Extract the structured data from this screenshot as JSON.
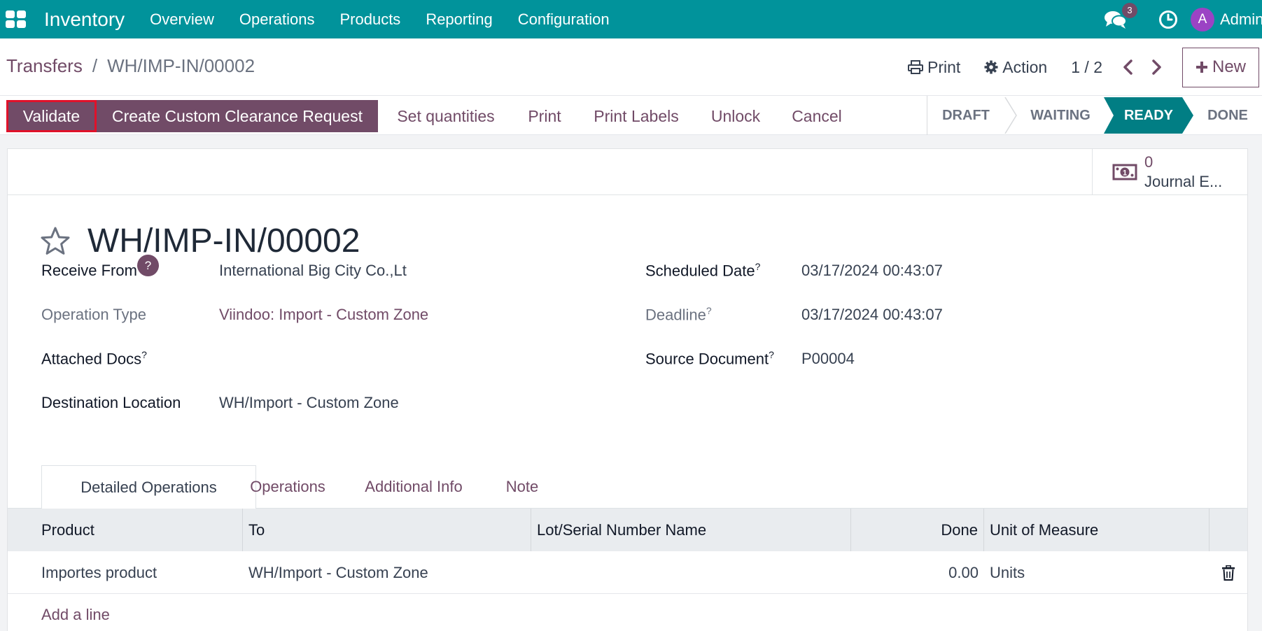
{
  "navbar": {
    "app_name": "Inventory",
    "menu": [
      "Overview",
      "Operations",
      "Products",
      "Reporting",
      "Configuration"
    ],
    "message_count": "3",
    "avatar_initial": "A",
    "user": "Admin",
    "color": "#01939b"
  },
  "breadcrumb": {
    "parent": "Transfers",
    "separator": "/",
    "current": "WH/IMP-IN/00002"
  },
  "control": {
    "print_label": "Print",
    "action_label": "Action",
    "pager": "1 / 2",
    "new_label": "New"
  },
  "actions": {
    "validate": "Validate",
    "custom_clearance": "Create Custom Clearance Request",
    "set_quantities": "Set quantities",
    "print": "Print",
    "print_labels": "Print Labels",
    "unlock": "Unlock",
    "cancel": "Cancel"
  },
  "stages": [
    "DRAFT",
    "WAITING",
    "READY",
    "DONE"
  ],
  "active_stage": "READY",
  "stat_button": {
    "value": "0",
    "label": "Journal E..."
  },
  "record": {
    "title": "WH/IMP-IN/00002",
    "receive_from_label": "Receive From",
    "receive_from": "International Big City Co.,Lt",
    "operation_type_label": "Operation Type",
    "operation_type": "Viindoo: Import - Custom Zone",
    "attached_docs_label": "Attached Docs",
    "destination_label": "Destination Location",
    "destination": "WH/Import - Custom Zone",
    "scheduled_date_label": "Scheduled Date",
    "scheduled_date": "03/17/2024 00:43:07",
    "deadline_label": "Deadline",
    "deadline": "03/17/2024 00:43:07",
    "source_document_label": "Source Document",
    "source_document": "P00004",
    "help_mark": "?"
  },
  "tabs": [
    "Detailed Operations",
    "Operations",
    "Additional Info",
    "Note"
  ],
  "table": {
    "columns": [
      "Product",
      "To",
      "Lot/Serial Number Name",
      "Done",
      "Unit of Measure"
    ],
    "rows": [
      {
        "product": "Importes product",
        "to": "WH/Import - Custom Zone",
        "lot": "",
        "done": "0.00",
        "uom": "Units"
      }
    ],
    "add_line": "Add a line"
  },
  "colors": {
    "primary": "#714b67",
    "stage_active": "#017e84",
    "highlight": "#e0112a"
  }
}
